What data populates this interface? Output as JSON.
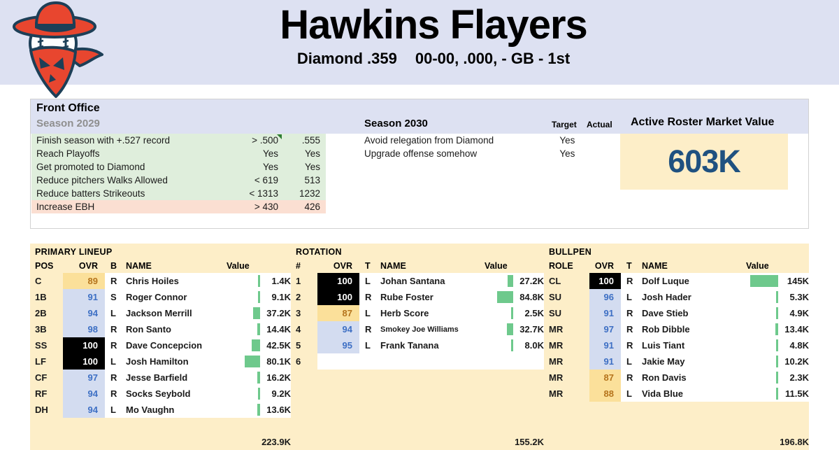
{
  "header": {
    "team_name": "Hawkins Flayers",
    "league": "Diamond .359",
    "record": "00-00, .000, - GB - 1st",
    "logo_icon": "cowboy-bandit-baseball-logo",
    "band_color": "#dde1f2"
  },
  "front_office": {
    "title": "Front Office",
    "season_past_label": "Season 2029",
    "season_current_label": "Season 2030",
    "col_target": "Target",
    "col_actual": "Actual",
    "past_goals": [
      {
        "label": "Finish season with +.527 record",
        "target": "> .500",
        "actual": ".555",
        "status": "ok",
        "flagged": true
      },
      {
        "label": "Reach Playoffs",
        "target": "Yes",
        "actual": "Yes",
        "status": "ok",
        "flagged": false
      },
      {
        "label": "Get promoted to Diamond",
        "target": "Yes",
        "actual": "Yes",
        "status": "ok",
        "flagged": false
      },
      {
        "label": "Reduce pitchers Walks Allowed",
        "target": "< 619",
        "actual": "513",
        "status": "ok",
        "flagged": false
      },
      {
        "label": "Reduce batters Strikeouts",
        "target": "< 1313",
        "actual": "1232",
        "status": "ok",
        "flagged": false
      },
      {
        "label": "Increase EBH",
        "target": "> 430",
        "actual": "426",
        "status": "fail",
        "flagged": false
      }
    ],
    "current_goals": [
      {
        "label": "Avoid relegation from Diamond",
        "target": "Yes",
        "actual": ""
      },
      {
        "label": "Upgrade offense somehow",
        "target": "Yes",
        "actual": ""
      }
    ],
    "market_value": {
      "title": "Active Roster Market Value",
      "value": "603K",
      "box_color": "#fdeec8",
      "text_color": "#1f5180"
    }
  },
  "roster": {
    "bar_max": 145,
    "lineup": {
      "section_title": "PRIMARY LINEUP",
      "columns": [
        "POS",
        "OVR",
        "B",
        "NAME",
        "Value"
      ],
      "rows": [
        {
          "pos": "C",
          "ovr": "89",
          "tier": "tier-gold",
          "hand": "R",
          "name": "Chris Hoiles",
          "value": "1.4K",
          "num": 1.4
        },
        {
          "pos": "1B",
          "ovr": "91",
          "tier": "tier-blue",
          "hand": "S",
          "name": "Roger Connor",
          "value": "9.1K",
          "num": 9.1
        },
        {
          "pos": "2B",
          "ovr": "94",
          "tier": "tier-blue",
          "hand": "L",
          "name": "Jackson Merrill",
          "value": "37.2K",
          "num": 37.2
        },
        {
          "pos": "3B",
          "ovr": "98",
          "tier": "tier-blue",
          "hand": "R",
          "name": "Ron Santo",
          "value": "14.4K",
          "num": 14.4
        },
        {
          "pos": "SS",
          "ovr": "100",
          "tier": "tier-black",
          "hand": "R",
          "name": "Dave Concepcion",
          "value": "42.5K",
          "num": 42.5
        },
        {
          "pos": "LF",
          "ovr": "100",
          "tier": "tier-black",
          "hand": "L",
          "name": "Josh Hamilton",
          "value": "80.1K",
          "num": 80.1
        },
        {
          "pos": "CF",
          "ovr": "97",
          "tier": "tier-blue",
          "hand": "R",
          "name": "Jesse Barfield",
          "value": "16.2K",
          "num": 16.2
        },
        {
          "pos": "RF",
          "ovr": "94",
          "tier": "tier-blue",
          "hand": "R",
          "name": "Socks Seybold",
          "value": "9.2K",
          "num": 9.2
        },
        {
          "pos": "DH",
          "ovr": "94",
          "tier": "tier-blue",
          "hand": "L",
          "name": "Mo Vaughn",
          "value": "13.6K",
          "num": 13.6
        }
      ],
      "total": "223.9K"
    },
    "rotation": {
      "section_title": "ROTATION",
      "columns": [
        "#",
        "OVR",
        "T",
        "NAME",
        "Value"
      ],
      "rows": [
        {
          "pos": "1",
          "ovr": "100",
          "tier": "tier-black",
          "hand": "L",
          "name": "Johan Santana",
          "value": "27.2K",
          "num": 27.2,
          "small": false
        },
        {
          "pos": "2",
          "ovr": "100",
          "tier": "tier-black",
          "hand": "R",
          "name": "Rube Foster",
          "value": "84.8K",
          "num": 84.8,
          "small": false
        },
        {
          "pos": "3",
          "ovr": "87",
          "tier": "tier-gold",
          "hand": "L",
          "name": "Herb Score",
          "value": "2.5K",
          "num": 2.5,
          "small": false
        },
        {
          "pos": "4",
          "ovr": "94",
          "tier": "tier-blue",
          "hand": "R",
          "name": "Smokey Joe Williams",
          "value": "32.7K",
          "num": 32.7,
          "small": true
        },
        {
          "pos": "5",
          "ovr": "95",
          "tier": "tier-blue",
          "hand": "L",
          "name": "Frank Tanana",
          "value": "8.0K",
          "num": 8.0,
          "small": false
        },
        {
          "pos": "6",
          "ovr": "",
          "tier": "empty",
          "hand": "",
          "name": "",
          "value": "",
          "num": 0,
          "small": false
        }
      ],
      "total": "155.2K"
    },
    "bullpen": {
      "section_title": "BULLPEN",
      "columns": [
        "ROLE",
        "OVR",
        "T",
        "NAME",
        "Value"
      ],
      "rows": [
        {
          "pos": "CL",
          "ovr": "100",
          "tier": "tier-black",
          "hand": "R",
          "name": "Dolf Luque",
          "value": "145K",
          "num": 145
        },
        {
          "pos": "SU",
          "ovr": "96",
          "tier": "tier-blue",
          "hand": "L",
          "name": "Josh Hader",
          "value": "5.3K",
          "num": 5.3
        },
        {
          "pos": "SU",
          "ovr": "91",
          "tier": "tier-blue",
          "hand": "R",
          "name": "Dave Stieb",
          "value": "4.9K",
          "num": 4.9
        },
        {
          "pos": "MR",
          "ovr": "97",
          "tier": "tier-blue",
          "hand": "R",
          "name": "Rob Dibble",
          "value": "13.4K",
          "num": 13.4
        },
        {
          "pos": "MR",
          "ovr": "91",
          "tier": "tier-blue",
          "hand": "R",
          "name": "Luis Tiant",
          "value": "4.8K",
          "num": 4.8
        },
        {
          "pos": "MR",
          "ovr": "91",
          "tier": "tier-blue",
          "hand": "L",
          "name": "Jakie May",
          "value": "10.2K",
          "num": 10.2
        },
        {
          "pos": "MR",
          "ovr": "87",
          "tier": "tier-gold",
          "hand": "R",
          "name": "Ron Davis",
          "value": "2.3K",
          "num": 2.3
        },
        {
          "pos": "MR",
          "ovr": "88",
          "tier": "tier-gold",
          "hand": "L",
          "name": "Vida Blue",
          "value": "11.5K",
          "num": 11.5
        }
      ],
      "total": "196.8K"
    }
  }
}
